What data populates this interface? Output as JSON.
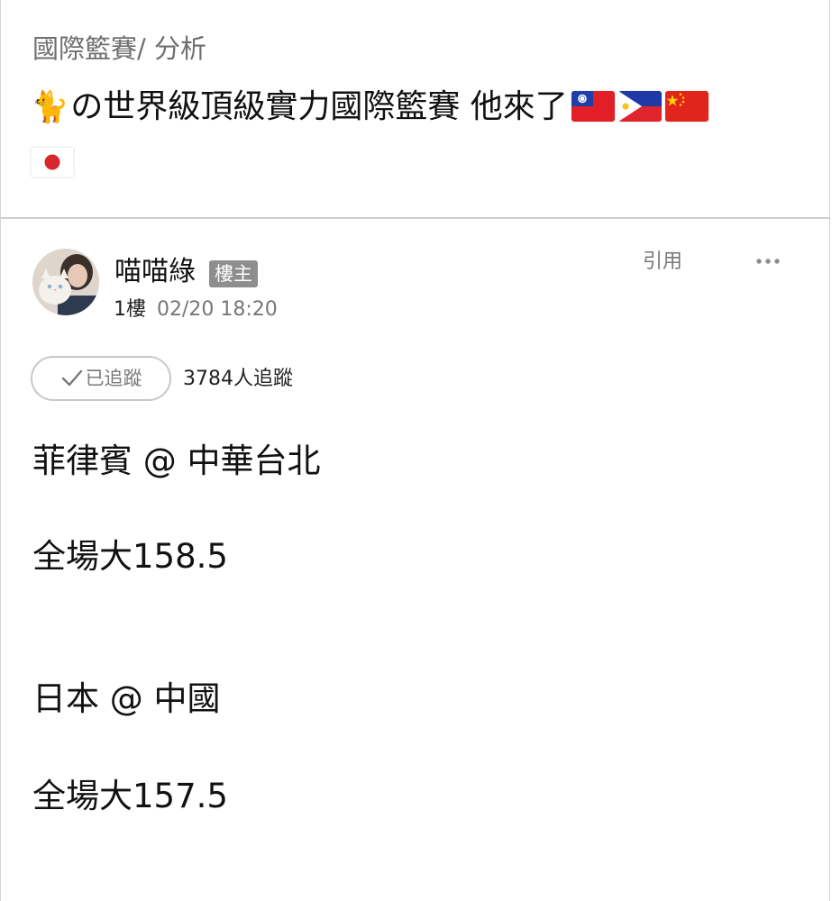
{
  "header": {
    "breadcrumb": "國際籃賽/ 分析",
    "title_icon": "cat-emoji",
    "title_emoji": "🐈",
    "title_text": "の世界級頂級實力國際籃賽 他來了",
    "flags": [
      "taiwan-flag",
      "philippines-flag",
      "china-flag",
      "japan-flag"
    ]
  },
  "post": {
    "author": "喵喵綠",
    "op_badge": "樓主",
    "floor": "1樓",
    "time": "02/20 18:20",
    "quote_label": "引用",
    "more_icon": "more-dots-icon",
    "follow_label": "已追蹤",
    "follow_count": "3784人追蹤",
    "content": [
      "菲律賓 @ 中華台北",
      "全場大158.5",
      "日本 @ 中國",
      "全場大157.5"
    ]
  },
  "colors": {
    "badge_bg": "#8e8e8e",
    "muted_text": "#777777",
    "divider": "#cfcfcf"
  }
}
